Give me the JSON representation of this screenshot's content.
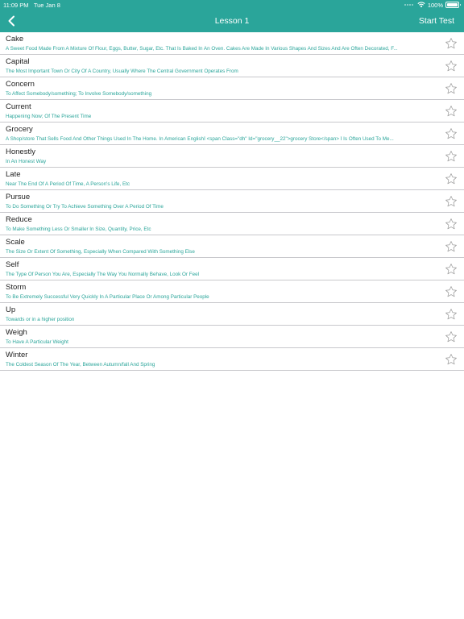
{
  "status_bar": {
    "time": "11:09 PM",
    "date": "Tue Jan 8",
    "battery": "100%"
  },
  "nav": {
    "title": "Lesson 1",
    "start_test": "Start Test",
    "back_icon": "chevron-left-icon"
  },
  "colors": {
    "accent": "#2aa59a",
    "text": "#222222",
    "separator": "#c8c8cc",
    "star_outline": "#9a9a9a"
  },
  "words": [
    {
      "word": "Cake",
      "definition": "A Sweet Food Made From A Mixture Of Flour, Eggs, Butter, Sugar, Etc. That Is Baked In An Oven. Cakes Are Made In Various Shapes And Sizes And Are Often Decorated, F..."
    },
    {
      "word": "Capital",
      "definition": "The Most Important Town Or City Of A Country, Usually Where The Central Government Operates From"
    },
    {
      "word": "Concern",
      "definition": "To Affect Somebody/something; To Involve Somebody/something"
    },
    {
      "word": "Current",
      "definition": "Happening Now; Of The Present Time"
    },
    {
      "word": "Grocery",
      "definition": "A Shop/store That Sells Food And Other Things Used In The Home. In American EnglishÏ <span Class=\"dh\" Id=\"grocery__22\">grocery Store</span> Ï Is Often Used To Me..."
    },
    {
      "word": "Honestly",
      "definition": "In An Honest Way"
    },
    {
      "word": "Late",
      "definition": "Near The End Of A Period Of Time, A Person's Life, Etc"
    },
    {
      "word": "Pursue",
      "definition": "To Do Something Or Try To Achieve Something Over A Period Of Time"
    },
    {
      "word": "Reduce",
      "definition": "To Make Something Less Or Smaller In Size, Quantity, Price, Etc"
    },
    {
      "word": "Scale",
      "definition": "The Size Or Extent Of Something, Especially When Compared With Something Else"
    },
    {
      "word": "Self",
      "definition": "The Type Of Person You Are, Especially The Way You Normally Behave, Look Or Feel"
    },
    {
      "word": "Storm",
      "definition": "To Be Extremely Successful Very Quickly In A Particular Place Or Among Particular People"
    },
    {
      "word": "Up",
      "definition": "Towards or in a higher position"
    },
    {
      "word": "Weigh",
      "definition": "To Have A Particular Weight"
    },
    {
      "word": "Winter",
      "definition": "The Coldest Season Of The Year, Between Autumn/fall And Spring"
    }
  ]
}
